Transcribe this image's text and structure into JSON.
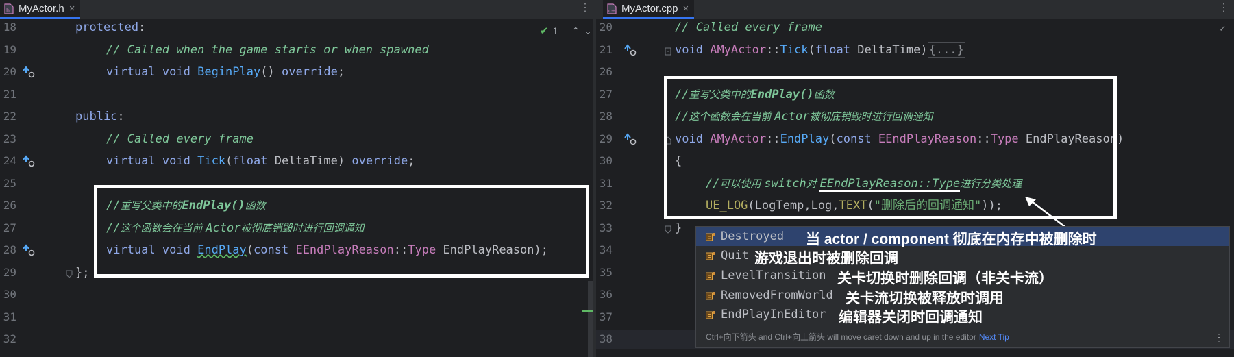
{
  "left": {
    "tab": {
      "filename": "MyActor.h"
    },
    "inspection": {
      "count": "1"
    },
    "lines": {
      "n18": "18",
      "n19": "19",
      "n20": "20",
      "n21": "21",
      "n22": "22",
      "n23": "23",
      "n24": "24",
      "n25": "25",
      "n26": "26",
      "n27": "27",
      "n28": "28",
      "n29": "29",
      "n30": "30",
      "n31": "31",
      "n32": "32",
      "protected": "protected",
      "colon": ":",
      "c19": "// Called when the game starts or when spawned",
      "virtual": "virtual",
      "void": "void",
      "beginplay": "BeginPlay",
      "override": "override",
      "parens": "()",
      "semi": ";",
      "public": "public",
      "c23": "// Called every frame",
      "tick": "Tick",
      "float": "float",
      "deltatime": "DeltaTime",
      "c26a": "//",
      "c26b": "重写父类中的",
      "c26c": "EndPlay()",
      "c26d": "函数",
      "c27a": "//",
      "c27b": "这个函数会在当前 ",
      "c27c": "Actor",
      "c27d": "被彻底销毁时进行回调通知",
      "endplay": "EndPlay",
      "const": "const",
      "eendplayreason": "EEndPlayReason",
      "scope": "::",
      "type": "Type",
      "param": "EndPlayReason",
      "close": "};"
    }
  },
  "right": {
    "tab": {
      "filename": "MyActor.cpp"
    },
    "lines": {
      "n20": "20",
      "n21": "21",
      "n26": "26",
      "n27": "27",
      "n28": "28",
      "n29": "29",
      "n30": "30",
      "n31": "31",
      "n32": "32",
      "n33": "33",
      "n34": "34",
      "n35": "35",
      "n36": "36",
      "n37": "37",
      "n38": "38",
      "c20": "// Called every frame",
      "void": "void",
      "amyactor": "AMyActor",
      "scope": "::",
      "tick": "Tick",
      "float": "float",
      "deltatime": "DeltaTime",
      "folded": "{...}",
      "c27a": "//",
      "c27b": "重写父类中的",
      "c27c": "EndPlay()",
      "c27d": "函数",
      "c28a": "//",
      "c28b": "这个函数会在当前 ",
      "c28c": "Actor",
      "c28d": "被彻底销毁时进行回调通知",
      "endplay": "EndPlay",
      "const": "const",
      "eendplayreason": "EEndPlayReason",
      "type": "Type",
      "param": "EndPlayReason",
      "lbrace": "{",
      "c31a": "//",
      "c31b": "可以使用 ",
      "c31c": "switch",
      "c31d": "对 ",
      "c31e": "EEndPlayReason::Type",
      "c31f": "进行分类处理",
      "uelog": "UE_LOG",
      "logtemp": "LogTemp",
      "log": "Log",
      "text": "TEXT",
      "strlit": "\"删除后的回调通知\"",
      "rbrace": "}"
    }
  },
  "completion": {
    "items": [
      {
        "name": "Destroyed",
        "note": "当 actor / component 彻底在内存中被删除时"
      },
      {
        "name": "Quit",
        "note": "游戏退出时被删除回调"
      },
      {
        "name": "LevelTransition",
        "note": "关卡切换时删除回调（非关卡流）"
      },
      {
        "name": "RemovedFromWorld",
        "note": "关卡流切换被释放时调用"
      },
      {
        "name": "EndPlayInEditor",
        "note": "编辑器关闭时回调通知"
      }
    ],
    "footer": "Ctrl+向下箭头 and Ctrl+向上箭头 will move caret down and up in the editor",
    "next_tip": "Next Tip"
  },
  "icons": {
    "file": "cpp-file-icon",
    "gutter": "override-method-icon",
    "enum": "enum-constant-icon"
  }
}
